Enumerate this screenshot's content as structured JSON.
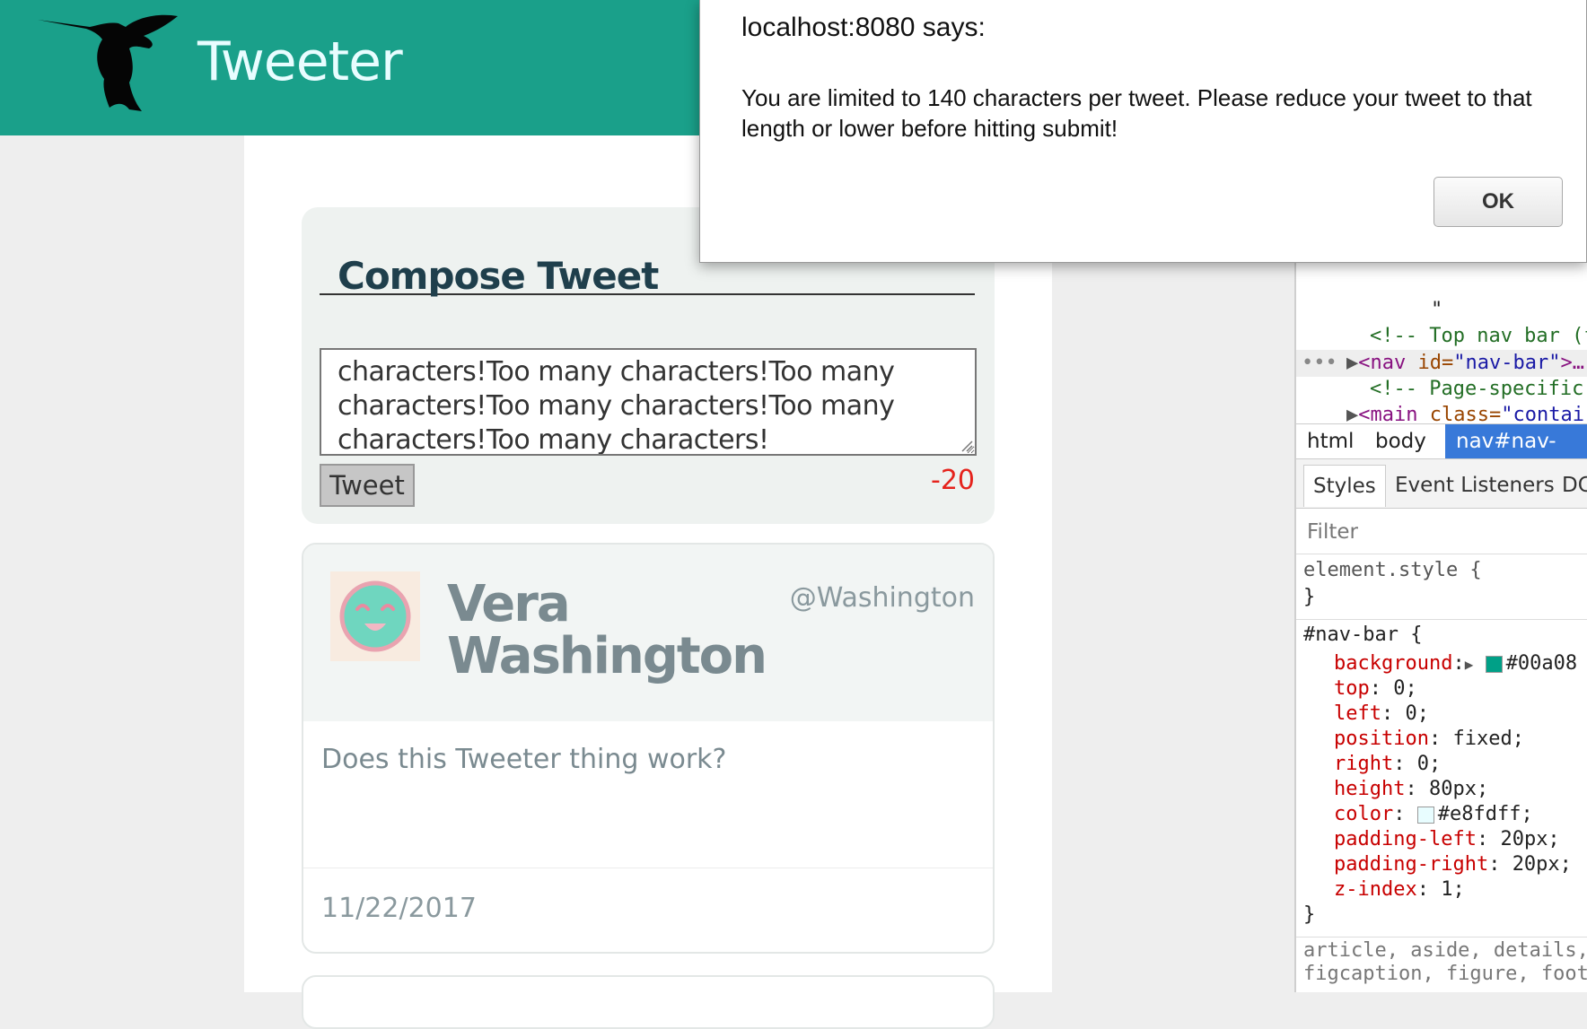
{
  "app": {
    "brand": "Tweeter"
  },
  "compose": {
    "title": "Compose Tweet",
    "textarea_value": "characters!Too many characters!Too many characters!Too many characters!Too many characters!Too many characters!",
    "tweet_button": "Tweet",
    "counter": "-20"
  },
  "tweets": [
    {
      "name": "Vera Washington",
      "handle": "@Washington",
      "body": "Does this Tweeter thing work?",
      "date": "11/22/2017"
    }
  ],
  "alert": {
    "title": "localhost:8080 says:",
    "message": "You are limited to 140 characters per tweet.  Please reduce your tweet to that length or lower before hitting submit!",
    "ok_label": "OK"
  },
  "devtools": {
    "dom": {
      "quote": "\"",
      "comment1": "<!-- Top nav bar (f",
      "ellipsis": "•••",
      "nav_tag": "<nav ",
      "nav_attr": "id=",
      "nav_val": "\"nav-bar\"",
      "nav_end": ">…",
      "comment2": "<!-- Page-specific",
      "main_tag": "<main ",
      "main_attr": "class=",
      "main_val": "\"contai"
    },
    "breadcrumbs": [
      "html",
      "body",
      "nav#nav-bar"
    ],
    "tabs": [
      "Styles",
      "Event Listeners",
      "DC"
    ],
    "filter_placeholder": "Filter",
    "element_style": {
      "selector": "element.style {",
      "close": "}"
    },
    "nav_rule": {
      "selector": "#nav-bar {",
      "declarations": [
        {
          "prop": "background",
          "value": "#00a08"
        },
        {
          "prop": "top",
          "value": "0;"
        },
        {
          "prop": "left",
          "value": "0;"
        },
        {
          "prop": "position",
          "value": "fixed;"
        },
        {
          "prop": "right",
          "value": "0;"
        },
        {
          "prop": "height",
          "value": "80px;"
        },
        {
          "prop": "color",
          "value": "#e8fdff;"
        },
        {
          "prop": "padding-left",
          "value": "20px;"
        },
        {
          "prop": "padding-right",
          "value": "20px;"
        },
        {
          "prop": "z-index",
          "value": "1;"
        }
      ],
      "close": "}"
    },
    "next_rule": {
      "line1": "article, aside, details,",
      "line2": "figcaption, figure, foot"
    }
  },
  "colors": {
    "nav_bg": "#1aa08a",
    "brand_text": "#e8fdff",
    "counter_red": "#e5231c",
    "swatch_background": "#00a087",
    "swatch_color": "#e8fdff",
    "breadcrumb_active": "#3879d9"
  },
  "icons": {
    "logo": "hummingbird-logo-icon",
    "avatar": "smiley-avatar-icon"
  }
}
